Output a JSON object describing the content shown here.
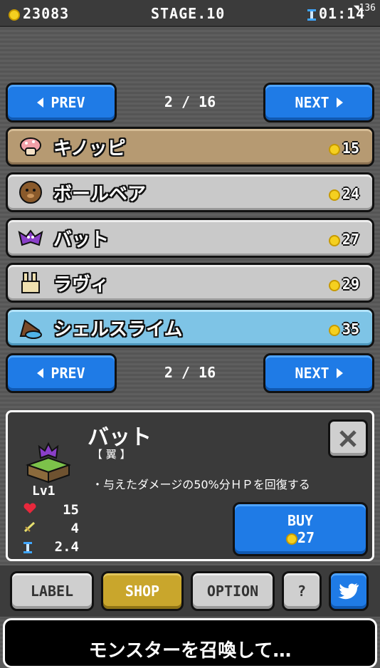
{
  "topbar": {
    "gold": "23083",
    "stage": "STAGE.10",
    "timer": "01:14",
    "status_number": "136"
  },
  "pager_top": {
    "prev_label": "PREV",
    "page": "2 / 16",
    "next_label": "NEXT"
  },
  "monsters": [
    {
      "name": "キノッピ",
      "price": "15",
      "icon": "mushroom-icon",
      "style": "selected"
    },
    {
      "name": "ボールベア",
      "price": "24",
      "icon": "ball-bear-icon",
      "style": "normal"
    },
    {
      "name": "バット",
      "price": "27",
      "icon": "bat-icon",
      "style": "normal"
    },
    {
      "name": "ラヴィ",
      "price": "29",
      "icon": "rabbit-icon",
      "style": "normal"
    },
    {
      "name": "シェルスライム",
      "price": "35",
      "icon": "shell-slime-icon",
      "style": "cyan"
    }
  ],
  "pager_bottom": {
    "prev_label": "PREV",
    "page": "2 / 16",
    "next_label": "NEXT"
  },
  "detail": {
    "name": "バット",
    "type": "【 翼 】",
    "description": "・与えたダメージの50%分ＨＰを回復する",
    "level": "Lv1",
    "hp": "15",
    "attack": "4",
    "speed": "2.4",
    "buy_label": "BUY",
    "buy_price": "27"
  },
  "nav": {
    "label": "LABEL",
    "shop": "SHOP",
    "option": "OPTION",
    "help": "?"
  },
  "banner": {
    "text": "モンスターを召喚して…"
  },
  "colors": {
    "accent_blue": "#1f7be6",
    "selected_row": "#b69a72",
    "shop_yellow": "#c9a62c",
    "coin": "#f5d020"
  }
}
